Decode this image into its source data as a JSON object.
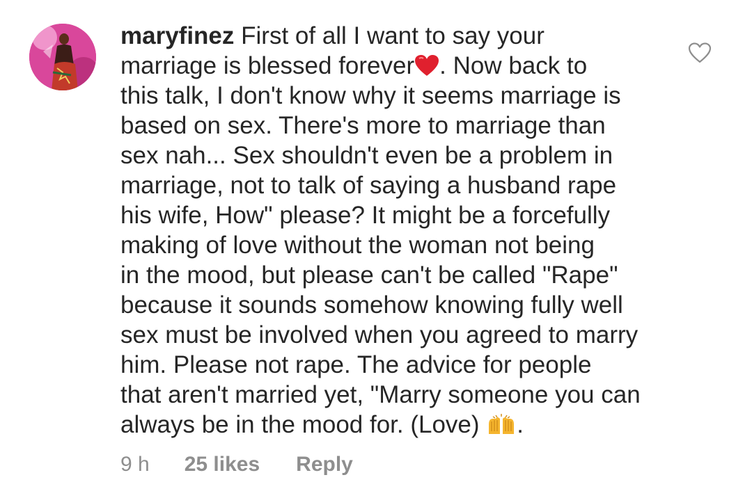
{
  "comment": {
    "username": "maryfinez",
    "text_part1": "First of all I want to say your\nmarriage is blessed forever",
    "emoji_heart": "red-heart",
    "text_part2": ". Now back to\nthis talk, I don't know why it seems marriage is\nbased on sex. There's more to marriage than\nsex nah... Sex shouldn't even be a problem in\nmarriage, not to talk of saying a husband rape\nhis wife, How\" please? It might be a forcefully\nmaking of love without the woman not being\nin the mood, but please can't be called \"Rape\"\nbecause it sounds somehow knowing fully well\nsex must be involved when you agreed to marry\nhim. Please not rape. The advice for people\nthat aren't married yet, \"Marry someone you can\nalways be in the mood for. (Love) ",
    "emoji_hands": "raising-hands",
    "text_end": ".",
    "time": "9 h",
    "likes": "25 likes",
    "reply": "Reply"
  },
  "icons": {
    "like": "heart-outline-icon",
    "avatar": "profile-photo"
  },
  "colors": {
    "text": "#262626",
    "meta": "#8e8e8e",
    "heart_emoji": "#e0202e",
    "hands_emoji": "#f5b52e"
  }
}
